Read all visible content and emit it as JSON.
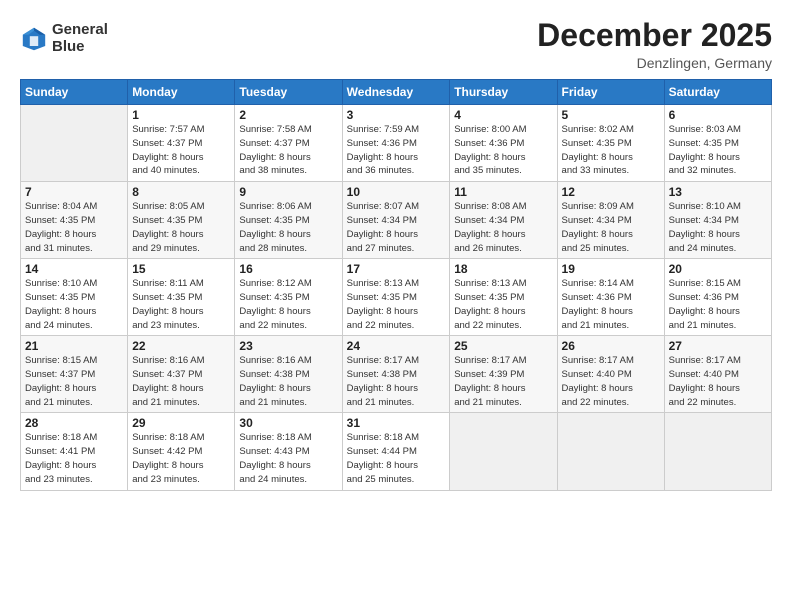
{
  "logo": {
    "line1": "General",
    "line2": "Blue"
  },
  "title": "December 2025",
  "location": "Denzlingen, Germany",
  "weekdays": [
    "Sunday",
    "Monday",
    "Tuesday",
    "Wednesday",
    "Thursday",
    "Friday",
    "Saturday"
  ],
  "weeks": [
    [
      {
        "day": "",
        "info": ""
      },
      {
        "day": "1",
        "info": "Sunrise: 7:57 AM\nSunset: 4:37 PM\nDaylight: 8 hours\nand 40 minutes."
      },
      {
        "day": "2",
        "info": "Sunrise: 7:58 AM\nSunset: 4:37 PM\nDaylight: 8 hours\nand 38 minutes."
      },
      {
        "day": "3",
        "info": "Sunrise: 7:59 AM\nSunset: 4:36 PM\nDaylight: 8 hours\nand 36 minutes."
      },
      {
        "day": "4",
        "info": "Sunrise: 8:00 AM\nSunset: 4:36 PM\nDaylight: 8 hours\nand 35 minutes."
      },
      {
        "day": "5",
        "info": "Sunrise: 8:02 AM\nSunset: 4:35 PM\nDaylight: 8 hours\nand 33 minutes."
      },
      {
        "day": "6",
        "info": "Sunrise: 8:03 AM\nSunset: 4:35 PM\nDaylight: 8 hours\nand 32 minutes."
      }
    ],
    [
      {
        "day": "7",
        "info": "Sunrise: 8:04 AM\nSunset: 4:35 PM\nDaylight: 8 hours\nand 31 minutes."
      },
      {
        "day": "8",
        "info": "Sunrise: 8:05 AM\nSunset: 4:35 PM\nDaylight: 8 hours\nand 29 minutes."
      },
      {
        "day": "9",
        "info": "Sunrise: 8:06 AM\nSunset: 4:35 PM\nDaylight: 8 hours\nand 28 minutes."
      },
      {
        "day": "10",
        "info": "Sunrise: 8:07 AM\nSunset: 4:34 PM\nDaylight: 8 hours\nand 27 minutes."
      },
      {
        "day": "11",
        "info": "Sunrise: 8:08 AM\nSunset: 4:34 PM\nDaylight: 8 hours\nand 26 minutes."
      },
      {
        "day": "12",
        "info": "Sunrise: 8:09 AM\nSunset: 4:34 PM\nDaylight: 8 hours\nand 25 minutes."
      },
      {
        "day": "13",
        "info": "Sunrise: 8:10 AM\nSunset: 4:34 PM\nDaylight: 8 hours\nand 24 minutes."
      }
    ],
    [
      {
        "day": "14",
        "info": "Sunrise: 8:10 AM\nSunset: 4:35 PM\nDaylight: 8 hours\nand 24 minutes."
      },
      {
        "day": "15",
        "info": "Sunrise: 8:11 AM\nSunset: 4:35 PM\nDaylight: 8 hours\nand 23 minutes."
      },
      {
        "day": "16",
        "info": "Sunrise: 8:12 AM\nSunset: 4:35 PM\nDaylight: 8 hours\nand 22 minutes."
      },
      {
        "day": "17",
        "info": "Sunrise: 8:13 AM\nSunset: 4:35 PM\nDaylight: 8 hours\nand 22 minutes."
      },
      {
        "day": "18",
        "info": "Sunrise: 8:13 AM\nSunset: 4:35 PM\nDaylight: 8 hours\nand 22 minutes."
      },
      {
        "day": "19",
        "info": "Sunrise: 8:14 AM\nSunset: 4:36 PM\nDaylight: 8 hours\nand 21 minutes."
      },
      {
        "day": "20",
        "info": "Sunrise: 8:15 AM\nSunset: 4:36 PM\nDaylight: 8 hours\nand 21 minutes."
      }
    ],
    [
      {
        "day": "21",
        "info": "Sunrise: 8:15 AM\nSunset: 4:37 PM\nDaylight: 8 hours\nand 21 minutes."
      },
      {
        "day": "22",
        "info": "Sunrise: 8:16 AM\nSunset: 4:37 PM\nDaylight: 8 hours\nand 21 minutes."
      },
      {
        "day": "23",
        "info": "Sunrise: 8:16 AM\nSunset: 4:38 PM\nDaylight: 8 hours\nand 21 minutes."
      },
      {
        "day": "24",
        "info": "Sunrise: 8:17 AM\nSunset: 4:38 PM\nDaylight: 8 hours\nand 21 minutes."
      },
      {
        "day": "25",
        "info": "Sunrise: 8:17 AM\nSunset: 4:39 PM\nDaylight: 8 hours\nand 21 minutes."
      },
      {
        "day": "26",
        "info": "Sunrise: 8:17 AM\nSunset: 4:40 PM\nDaylight: 8 hours\nand 22 minutes."
      },
      {
        "day": "27",
        "info": "Sunrise: 8:17 AM\nSunset: 4:40 PM\nDaylight: 8 hours\nand 22 minutes."
      }
    ],
    [
      {
        "day": "28",
        "info": "Sunrise: 8:18 AM\nSunset: 4:41 PM\nDaylight: 8 hours\nand 23 minutes."
      },
      {
        "day": "29",
        "info": "Sunrise: 8:18 AM\nSunset: 4:42 PM\nDaylight: 8 hours\nand 23 minutes."
      },
      {
        "day": "30",
        "info": "Sunrise: 8:18 AM\nSunset: 4:43 PM\nDaylight: 8 hours\nand 24 minutes."
      },
      {
        "day": "31",
        "info": "Sunrise: 8:18 AM\nSunset: 4:44 PM\nDaylight: 8 hours\nand 25 minutes."
      },
      {
        "day": "",
        "info": ""
      },
      {
        "day": "",
        "info": ""
      },
      {
        "day": "",
        "info": ""
      }
    ]
  ]
}
